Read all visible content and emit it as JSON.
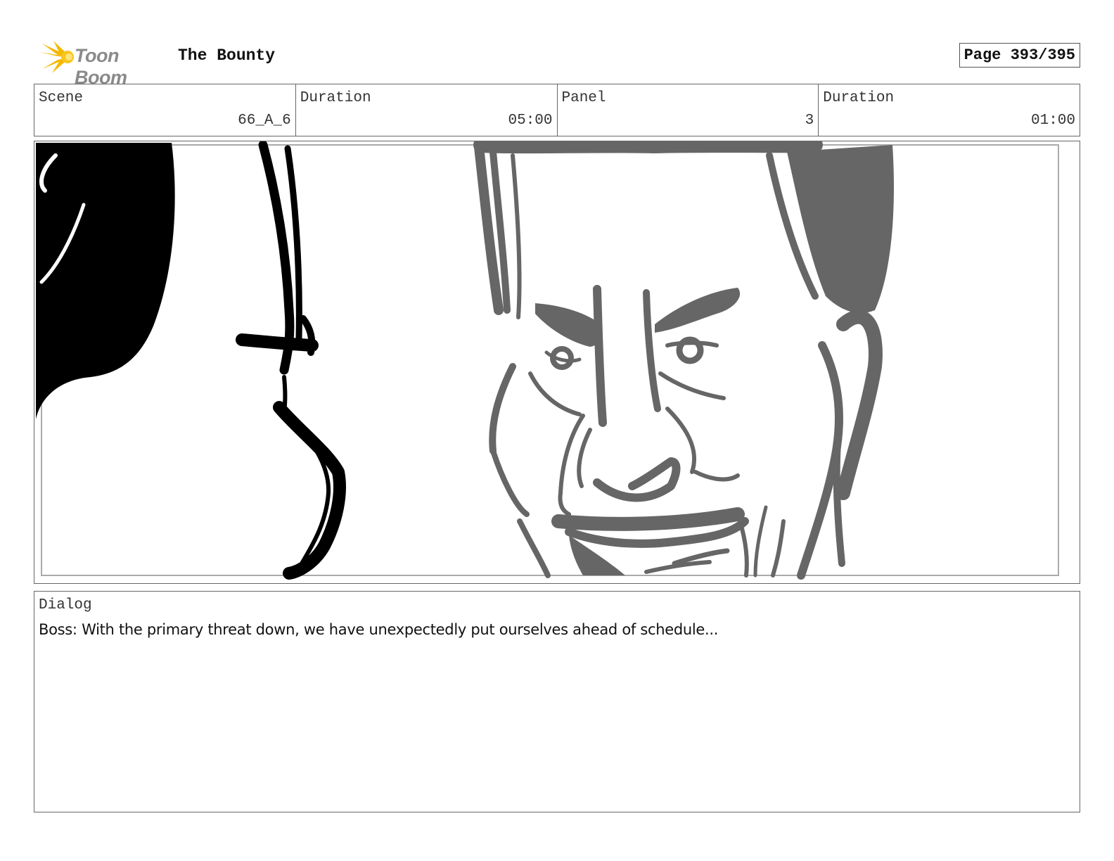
{
  "header": {
    "logo_text": "Toon Boom",
    "project_title": "The Bounty",
    "page_label": "Page 393/395"
  },
  "info": {
    "scene_label": "Scene",
    "scene_value": "66_A_6",
    "scene_duration_label": "Duration",
    "scene_duration_value": "05:00",
    "panel_label": "Panel",
    "panel_value": "3",
    "panel_duration_label": "Duration",
    "panel_duration_value": "01:00"
  },
  "dialog": {
    "label": "Dialog",
    "text": "Boss: With the primary threat down, we have unexpectedly put ourselves ahead of schedule..."
  },
  "colors": {
    "logo_accent": "#f5b800",
    "sketch_dark": "#000000",
    "sketch_gray": "#666666"
  }
}
